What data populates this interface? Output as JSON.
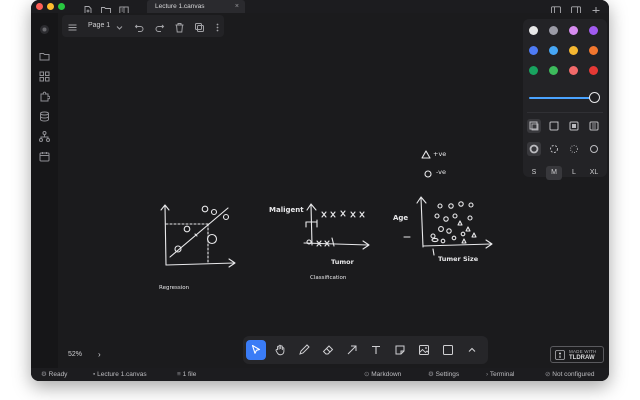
{
  "app": {
    "tab_title": "Lecture 1.canvas",
    "tab_close": "×",
    "traffic_lights": {
      "close": "#ff5f57",
      "minimize": "#febc2e",
      "zoom": "#28c840"
    },
    "titlebar_icons": [
      "new-file-icon",
      "open-folder-icon",
      "book-icon"
    ],
    "titlebar_right_icons": [
      "sidebar-left-icon",
      "sidebar-right-icon",
      "new-tab-icon"
    ]
  },
  "sidebar": {
    "icons": [
      "app-logo-icon",
      "folder-icon",
      "grid-icon",
      "puzzle-icon",
      "database-icon",
      "graph-icon",
      "calendar-icon"
    ]
  },
  "top_menu": {
    "page_label": "Page 1",
    "icons": [
      "hamburger-icon",
      "chevron-down-icon",
      "undo-icon",
      "redo-icon",
      "trash-icon",
      "duplicate-icon",
      "more-icon"
    ]
  },
  "style_panel": {
    "colors": [
      "#e8e8e8",
      "#9b9ba6",
      "#d78cf0",
      "#a15af0",
      "#4e7bf5",
      "#46a6f5",
      "#f5b731",
      "#f2772f",
      "#18a35f",
      "#3dbb5c",
      "#f26a6a",
      "#e53935"
    ],
    "opacity": 1,
    "accent": "#4aa3ff",
    "fill_icons": [
      "fill-none-icon",
      "fill-semi-icon",
      "fill-solid-icon",
      "fill-pattern-icon"
    ],
    "dash_icons": [
      "dash-draw-icon",
      "dash-dashed-icon",
      "dash-dotted-icon",
      "dash-solid-icon"
    ],
    "sizes": [
      "S",
      "M",
      "L",
      "XL"
    ],
    "selected_size": "M"
  },
  "drawing": {
    "regression_label": "Regression",
    "classification_label": "Classification",
    "maligent_label": "Maligent",
    "tumor_label": "Tumor",
    "age_label": "Age",
    "tumer_size_label": "Tumer Size",
    "legend_pos": "+ve",
    "legend_neg": "-ve"
  },
  "zoom": {
    "level": "52%",
    "chevron": "›"
  },
  "toolbar": {
    "tools": [
      "select-tool",
      "hand-tool",
      "draw-tool",
      "eraser-tool",
      "arrow-tool",
      "text-tool",
      "note-tool",
      "image-tool",
      "rectangle-tool",
      "more-tools"
    ],
    "selected": "select-tool"
  },
  "badge": {
    "line1": "MADE WITH",
    "line2": "TLDRAW"
  },
  "status": {
    "ready": "Ready",
    "file": "Lecture 1.canvas",
    "file_count": "1 file",
    "markdown": "Markdown",
    "settings": "Settings",
    "terminal": "Terminal",
    "connection": "Not configured"
  }
}
